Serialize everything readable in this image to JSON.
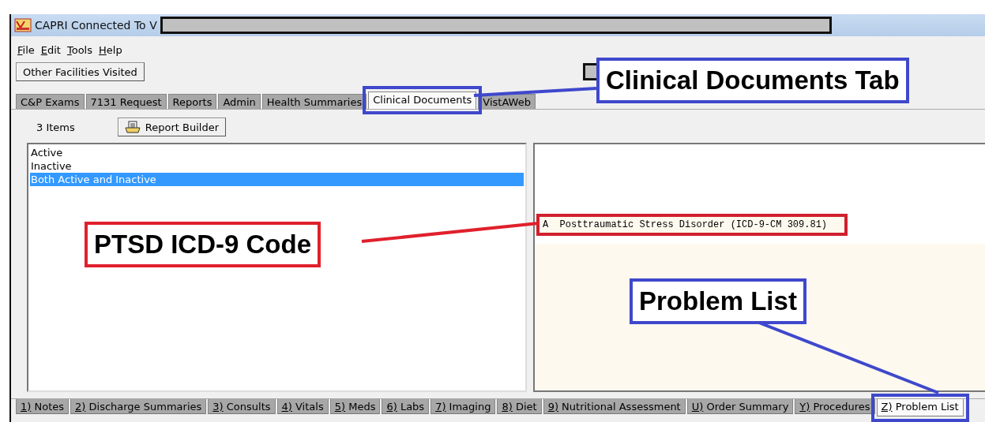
{
  "window": {
    "title": "CAPRI Connected To V"
  },
  "menu": [
    "File",
    "Edit",
    "Tools",
    "Help"
  ],
  "toolbar_button": "Other Facilities Visited",
  "top_tabs": [
    {
      "label": "C&P Exams",
      "selected": false,
      "highlighted": false
    },
    {
      "label": "7131 Request",
      "selected": false,
      "highlighted": false
    },
    {
      "label": "Reports",
      "selected": false,
      "highlighted": false
    },
    {
      "label": "Admin",
      "selected": false,
      "highlighted": false
    },
    {
      "label": "Health Summaries",
      "selected": false,
      "highlighted": false
    },
    {
      "label": "Clinical Documents",
      "selected": true,
      "highlighted": true
    },
    {
      "label": "VistAWeb",
      "selected": false,
      "highlighted": false
    }
  ],
  "panel": {
    "item_count": "3 Items",
    "report_button": "Report Builder",
    "filter_list": [
      {
        "label": "Active",
        "selected": false
      },
      {
        "label": "Inactive",
        "selected": false
      },
      {
        "label": "Both Active and Inactive",
        "selected": true
      }
    ],
    "report_lines": [
      {
        "text": "A  Posttraumatic Stress Disorder (ICD-9-CM 309.81)",
        "highlighted": true
      }
    ]
  },
  "bottom_tabs": [
    {
      "label": "1) Notes",
      "selected": false,
      "highlighted": false
    },
    {
      "label": "2) Discharge Summaries",
      "selected": false,
      "highlighted": false
    },
    {
      "label": "3) Consults",
      "selected": false,
      "highlighted": false
    },
    {
      "label": "4) Vitals",
      "selected": false,
      "highlighted": false
    },
    {
      "label": "5) Meds",
      "selected": false,
      "highlighted": false
    },
    {
      "label": "6) Labs",
      "selected": false,
      "highlighted": false
    },
    {
      "label": "7) Imaging",
      "selected": false,
      "highlighted": false
    },
    {
      "label": "8) Diet",
      "selected": false,
      "highlighted": false
    },
    {
      "label": "9) Nutritional Assessment",
      "selected": false,
      "highlighted": false
    },
    {
      "label": "U) Order Summary",
      "selected": false,
      "highlighted": false
    },
    {
      "label": "Y) Procedures",
      "selected": false,
      "highlighted": false
    },
    {
      "label": "Z) Problem List",
      "selected": true,
      "highlighted": true
    }
  ],
  "callouts": [
    {
      "text": "Clinical Documents Tab",
      "color": "#3f48cc"
    },
    {
      "text": "PTSD ICD-9 Code",
      "color": "#e0202c"
    },
    {
      "text": "Problem List",
      "color": "#3f48cc"
    }
  ]
}
